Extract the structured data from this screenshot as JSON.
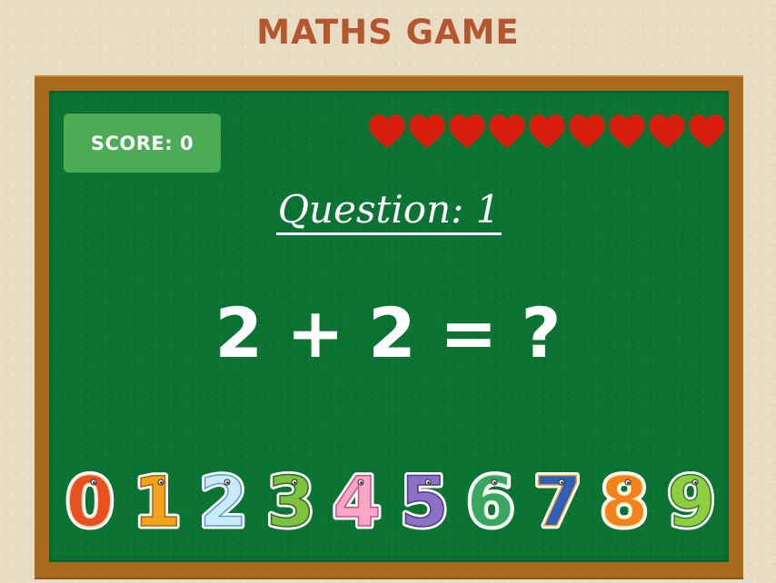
{
  "header": {
    "title": "MATHS GAME"
  },
  "hud": {
    "score_label": "SCORE: 0",
    "lives_total": 9,
    "lives_remaining": 9,
    "heart_icon": "heart-icon",
    "heart_color": "#d81e0f"
  },
  "question": {
    "label": "Question: 1",
    "operand_a": "2",
    "operator": "+",
    "operand_b": "2",
    "equals": "=",
    "unknown": "?"
  },
  "answer_buttons": [
    {
      "label": "0",
      "color": "#e9501f",
      "accent": "#ffd7b0",
      "icon": "fox-zero-icon"
    },
    {
      "label": "1",
      "color": "#f2a31b",
      "accent": "#a66712",
      "icon": "giraffe-one-icon"
    },
    {
      "label": "2",
      "color": "#cdeaf8",
      "accent": "#4f9fd2",
      "icon": "swan-two-icon"
    },
    {
      "label": "3",
      "color": "#7fc241",
      "accent": "#2f6b1c",
      "icon": "caterpillar-three-icon"
    },
    {
      "label": "4",
      "color": "#f7a7c3",
      "accent": "#d04d86",
      "icon": "flamingo-four-icon"
    },
    {
      "label": "5",
      "color": "#8a72c6",
      "accent": "#4b3a8a",
      "icon": "seahorse-five-icon"
    },
    {
      "label": "6",
      "color": "#3aa463",
      "accent": "#e6f5da",
      "icon": "snake-six-icon"
    },
    {
      "label": "7",
      "color": "#2f5fb8",
      "accent": "#f5a623",
      "icon": "toucan-seven-icon"
    },
    {
      "label": "8",
      "color": "#f5811d",
      "accent": "#fff2b0",
      "icon": "owl-eight-icon"
    },
    {
      "label": "9",
      "color": "#8fcf3f",
      "accent": "#2d7d2a",
      "icon": "crocodile-nine-icon"
    }
  ]
}
